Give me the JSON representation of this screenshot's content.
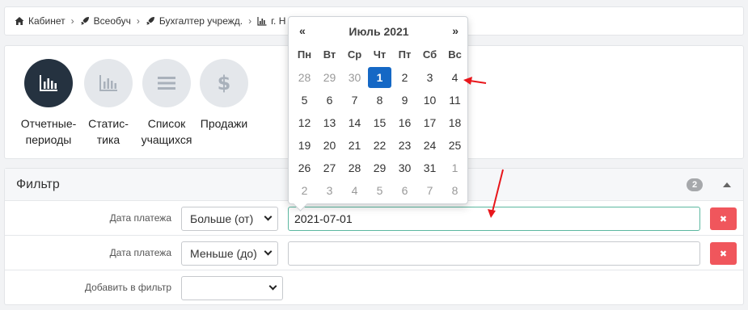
{
  "breadcrumb": [
    {
      "label": "Кабинет",
      "icon": "home-icon"
    },
    {
      "label": "Всеобуч",
      "icon": "rocket-icon"
    },
    {
      "label": "Бухгалтер учрежд.",
      "icon": "rocket-icon"
    },
    {
      "label": "г. Н",
      "icon": "bar-chart-icon"
    }
  ],
  "actions": [
    {
      "label": "Отчетные-\nпериоды",
      "icon": "bar-chart-icon",
      "active": true
    },
    {
      "label": "Статис-\nтика",
      "icon": "bar-chart-icon",
      "active": false
    },
    {
      "label": "Список\nучащихся",
      "icon": "list-icon",
      "active": false
    },
    {
      "label": "Продажи",
      "icon": "dollar-icon",
      "active": false
    }
  ],
  "filter": {
    "title": "Фильтр",
    "count": "2",
    "rows": [
      {
        "label": "Дата платежа",
        "operator": "Больше (от)",
        "value": "2021-07-01"
      },
      {
        "label": "Дата платежа",
        "operator": "Меньше (до)",
        "value": ""
      },
      {
        "label": "Добавить в фильтр",
        "operator": ""
      }
    ],
    "delete_label": "✖"
  },
  "datepicker": {
    "prev": "«",
    "next": "»",
    "title": "Июль 2021",
    "weekdays": [
      "Пн",
      "Вт",
      "Ср",
      "Чт",
      "Пт",
      "Сб",
      "Вс"
    ],
    "weeks": [
      [
        "28",
        "29",
        "30",
        "1",
        "2",
        "3",
        "4"
      ],
      [
        "5",
        "6",
        "7",
        "8",
        "9",
        "10",
        "11"
      ],
      [
        "12",
        "13",
        "14",
        "15",
        "16",
        "17",
        "18"
      ],
      [
        "19",
        "20",
        "21",
        "22",
        "23",
        "24",
        "25"
      ],
      [
        "26",
        "27",
        "28",
        "29",
        "30",
        "31",
        "1"
      ],
      [
        "2",
        "3",
        "4",
        "5",
        "6",
        "7",
        "8"
      ]
    ],
    "selected": "1"
  },
  "colors": {
    "accent": "#1568c5",
    "danger": "#f0565c",
    "annotation": "#e8161b",
    "icon_dark": "#253240"
  }
}
